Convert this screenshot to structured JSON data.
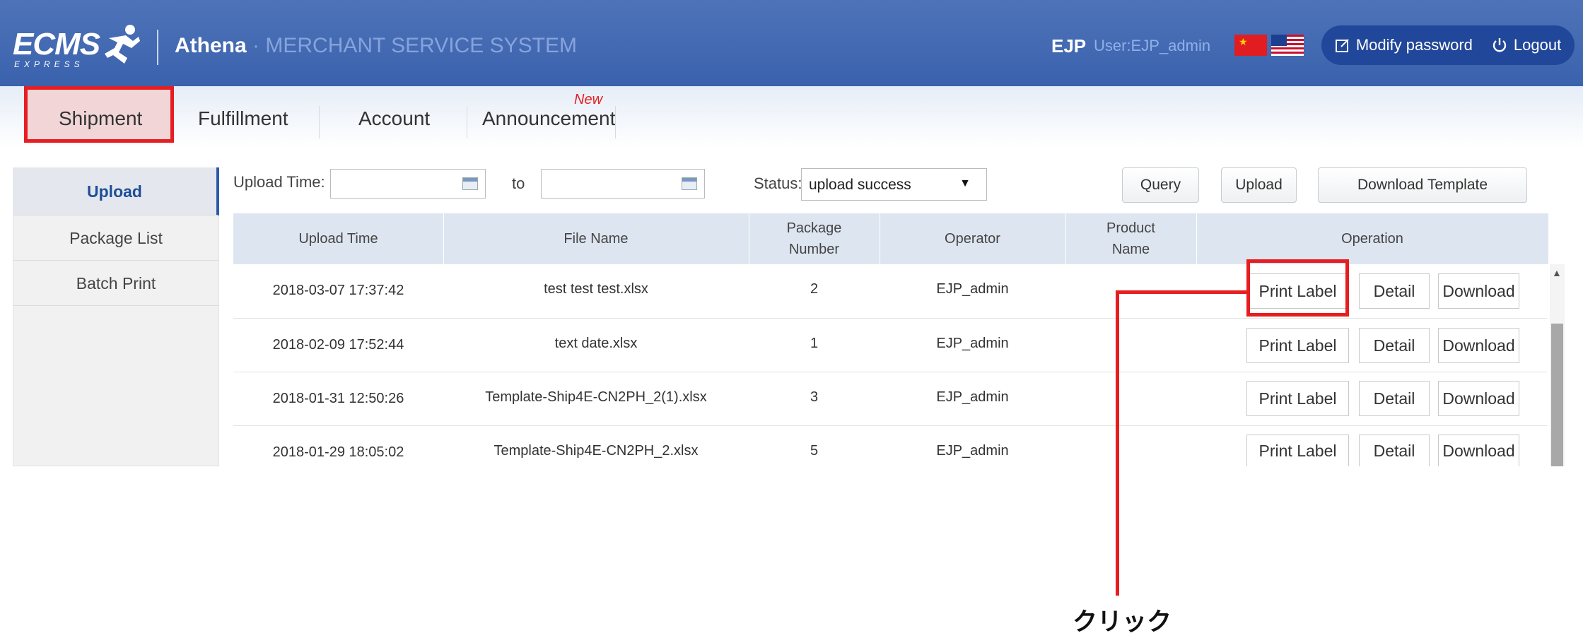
{
  "header": {
    "logo_text": "ECMS",
    "logo_sub": "EXPRESS",
    "brand_name": "Athena",
    "brand_sep": " · ",
    "brand_system": "MERCHANT SERVICE SYSTEM",
    "ejp": "EJP",
    "user": "User:EJP_admin",
    "modify_password": "Modify password",
    "logout": "Logout"
  },
  "nav": {
    "items": [
      "Shipment",
      "Fulfillment",
      "Account",
      "Announcement"
    ],
    "new_badge": "New"
  },
  "sidebar": {
    "items": [
      "Upload",
      "Package List",
      "Batch Print"
    ]
  },
  "filter": {
    "upload_time_label": "Upload Time:",
    "to_label": "to",
    "from_value": "",
    "to_value": "",
    "status_label": "Status:",
    "status_value": "upload success",
    "query": "Query",
    "upload": "Upload",
    "download_template": "Download Template"
  },
  "table": {
    "headers": [
      "Upload Time",
      "File Name",
      "Package\nNumber",
      "Operator",
      "Product\nName",
      "Operation"
    ],
    "header_pkg": [
      "Package",
      "Number"
    ],
    "header_prod": [
      "Product",
      "Name"
    ],
    "rows": [
      {
        "time": "2018-03-07 17:37:42",
        "file": "test test test.xlsx",
        "pkg": "2",
        "operator": "EJP_admin",
        "product": ""
      },
      {
        "time": "2018-02-09 17:52:44",
        "file": "text date.xlsx",
        "pkg": "1",
        "operator": "EJP_admin",
        "product": ""
      },
      {
        "time": "2018-01-31 12:50:26",
        "file": "Template-Ship4E-CN2PH_2(1).xlsx",
        "pkg": "3",
        "operator": "EJP_admin",
        "product": ""
      },
      {
        "time": "2018-01-29 18:05:02",
        "file": "Template-Ship4E-CN2PH_2.xlsx",
        "pkg": "5",
        "operator": "EJP_admin",
        "product": ""
      }
    ],
    "ops": {
      "print": "Print Label",
      "detail": "Detail",
      "download": "Download"
    }
  },
  "annotation": {
    "click": "クリック"
  },
  "colors": {
    "header_blue": "#3a62ad",
    "highlight_red": "#e61e22",
    "active_blue": "#1f4d99"
  }
}
